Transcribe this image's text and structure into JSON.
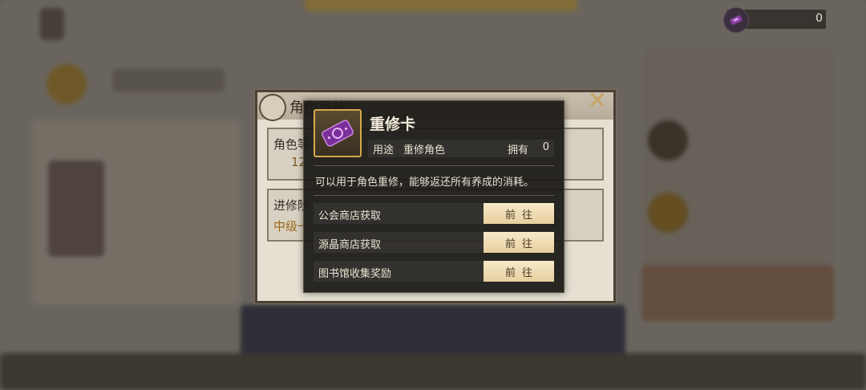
{
  "currency": {
    "icon": "repair-card-icon",
    "amount": "0"
  },
  "background_dialog": {
    "title": "角色系统",
    "card1": {
      "label": "角色等",
      "value": "12"
    },
    "card2": {
      "label": "进修阶",
      "value": "中级一"
    }
  },
  "tooltip": {
    "item_name": "重修卡",
    "usage_label": "用途",
    "usage_value": "重修角色",
    "owned_label": "拥有",
    "owned_count": "0",
    "description": "可以用于角色重修，能够返还所有养成的消耗。",
    "sources": [
      {
        "label": "公会商店获取",
        "button": "前往"
      },
      {
        "label": "源晶商店获取",
        "button": "前往"
      },
      {
        "label": "图书馆收集奖励",
        "button": "前往"
      }
    ]
  },
  "colors": {
    "accent_gold": "#d6a84c",
    "button_bg": "#f3e2bd",
    "panel_bg": "#1c1916"
  }
}
